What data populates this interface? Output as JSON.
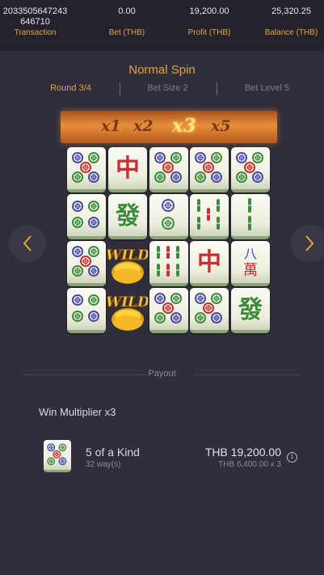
{
  "header": {
    "transaction": {
      "value": "2033505647243",
      "value2": "646710",
      "label": "Transaction"
    },
    "bet": {
      "value": "0.00",
      "label": "Bet (THB)"
    },
    "profit": {
      "value": "19,200.00",
      "label": "Profit (THB)"
    },
    "balance": {
      "value": "25,320.25",
      "label": "Balance (THB)"
    }
  },
  "spin": {
    "title": "Normal Spin",
    "round": "Round 3/4",
    "bet_size": "Bet Size 2",
    "bet_level": "Bet Level 5"
  },
  "multipliers": {
    "items": [
      "x1",
      "x2",
      "x3",
      "x5"
    ],
    "active_index": 2
  },
  "grid": {
    "columns": [
      [
        "circles-5",
        "circles-4",
        "circles-5",
        "circles-4"
      ],
      [
        "red-dragon",
        "green-dragon",
        "wild",
        "wild"
      ],
      [
        "circles-5",
        "circles-2",
        "bamboo-6",
        "circles-5"
      ],
      [
        "circles-5",
        "bamboo-5",
        "red-dragon",
        "circles-5"
      ],
      [
        "circles-5",
        "bamboo-2",
        "character-8",
        "green-dragon"
      ]
    ],
    "glyphs": {
      "red_dragon": "中",
      "green_dragon": "發",
      "eight": "八",
      "wan": "萬",
      "wild": "WILD"
    }
  },
  "payout": {
    "label": "Payout",
    "win_multiplier": "Win Multiplier x3",
    "rows": [
      {
        "symbol": "circles-5",
        "kind": "5 of a Kind",
        "ways": "32 way(s)",
        "amount": "THB 19,200.00",
        "calc": "THB 6,400.00 x 3",
        "info_icon": "info-icon"
      }
    ]
  },
  "navigation": {
    "left_icon": "chevron-left-icon",
    "right_icon": "chevron-right-icon"
  },
  "colors": {
    "accent": "#e4a23c",
    "background": "#2f2e3b",
    "header": "#23222d"
  }
}
